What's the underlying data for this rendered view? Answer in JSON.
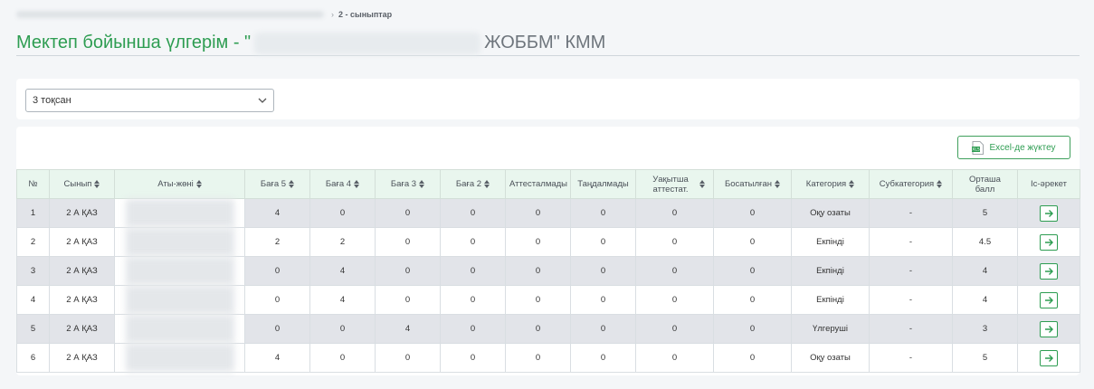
{
  "breadcrumb": {
    "current": "2 - сыныптар"
  },
  "title": {
    "prefix": "Мектеп бойынша үлгерім - \"",
    "suffix": "ЖОББМ\" КММ"
  },
  "filter": {
    "selected": "3 тоқсан"
  },
  "toolbar": {
    "excel_label": "Excel-де жүктеу",
    "excel_icon": "excel-file-icon"
  },
  "accent_color": "#2e9d52",
  "table": {
    "headers": [
      "№",
      "Сынып",
      "Аты-жөні",
      "Баға 5",
      "Баға 4",
      "Баға 3",
      "Баға 2",
      "Аттесталмады",
      "Таңдалмады",
      "Уақытша аттестат.",
      "Босатылған",
      "Категория",
      "Субкатегория",
      "Орташа балл",
      "Іс-әрекет"
    ],
    "rows": [
      {
        "n": "1",
        "class": "2 А ҚАЗ",
        "g5": "4",
        "g4": "0",
        "g3": "0",
        "g2": "0",
        "att": "0",
        "tan": "0",
        "temp": "0",
        "bos": "0",
        "cat": "Оқу озаты",
        "sub": "-",
        "avg": "5"
      },
      {
        "n": "2",
        "class": "2 А ҚАЗ",
        "g5": "2",
        "g4": "2",
        "g3": "0",
        "g2": "0",
        "att": "0",
        "tan": "0",
        "temp": "0",
        "bos": "0",
        "cat": "Екпінді",
        "sub": "-",
        "avg": "4.5"
      },
      {
        "n": "3",
        "class": "2 А ҚАЗ",
        "g5": "0",
        "g4": "4",
        "g3": "0",
        "g2": "0",
        "att": "0",
        "tan": "0",
        "temp": "0",
        "bos": "0",
        "cat": "Екпінді",
        "sub": "-",
        "avg": "4"
      },
      {
        "n": "4",
        "class": "2 А ҚАЗ",
        "g5": "0",
        "g4": "4",
        "g3": "0",
        "g2": "0",
        "att": "0",
        "tan": "0",
        "temp": "0",
        "bos": "0",
        "cat": "Екпінді",
        "sub": "-",
        "avg": "4"
      },
      {
        "n": "5",
        "class": "2 А ҚАЗ",
        "g5": "0",
        "g4": "0",
        "g3": "4",
        "g2": "0",
        "att": "0",
        "tan": "0",
        "temp": "0",
        "bos": "0",
        "cat": "Үлгеруші",
        "sub": "-",
        "avg": "3"
      },
      {
        "n": "6",
        "class": "2 А ҚАЗ",
        "g5": "4",
        "g4": "0",
        "g3": "0",
        "g2": "0",
        "att": "0",
        "tan": "0",
        "temp": "0",
        "bos": "0",
        "cat": "Оқу озаты",
        "sub": "-",
        "avg": "5"
      }
    ]
  }
}
